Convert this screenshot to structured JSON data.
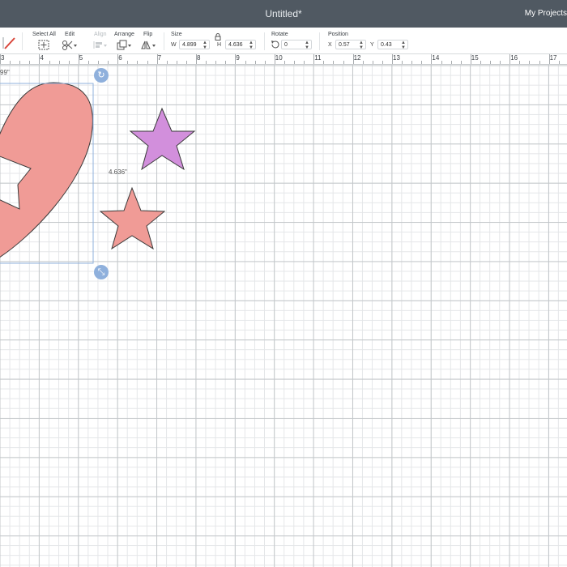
{
  "app": {
    "title": "Untitled*",
    "projects_label": "My Projects"
  },
  "toolbar": {
    "select_all": "Select All",
    "edit": "Edit",
    "align": "Align",
    "arrange": "Arrange",
    "flip": "Flip",
    "size": "Size",
    "size_w_label": "W",
    "size_w": "4.899",
    "size_h_label": "H",
    "size_h": "4.636",
    "rotate": "Rotate",
    "rotate_value": "0",
    "position": "Position",
    "pos_x_label": "X",
    "pos_x": "0.57",
    "pos_y_label": "Y",
    "pos_y": "0.43"
  },
  "ruler": {
    "labels": [
      "3",
      "4",
      "5",
      "6",
      "7",
      "8",
      "9",
      "10",
      "11",
      "12",
      "13",
      "14",
      "15",
      "16",
      "17"
    ]
  },
  "canvas": {
    "width_readout": "99\"",
    "height_readout": "4.636\"",
    "shapes": [
      {
        "name": "heart-half",
        "color": "#f09b96"
      },
      {
        "name": "star-purple",
        "color": "#d28fdc"
      },
      {
        "name": "star-pink",
        "color": "#f09b96"
      }
    ]
  },
  "colors": {
    "topbar": "#505962",
    "selection": "#8fb0dc",
    "grid": "#c3c7ca"
  },
  "icons": [
    "pen-icon",
    "select-all-icon",
    "edit-icon",
    "align-icon",
    "arrange-icon",
    "flip-icon",
    "lock-icon",
    "rotate-icon",
    "rotate-handle-icon",
    "resize-handle-icon"
  ]
}
